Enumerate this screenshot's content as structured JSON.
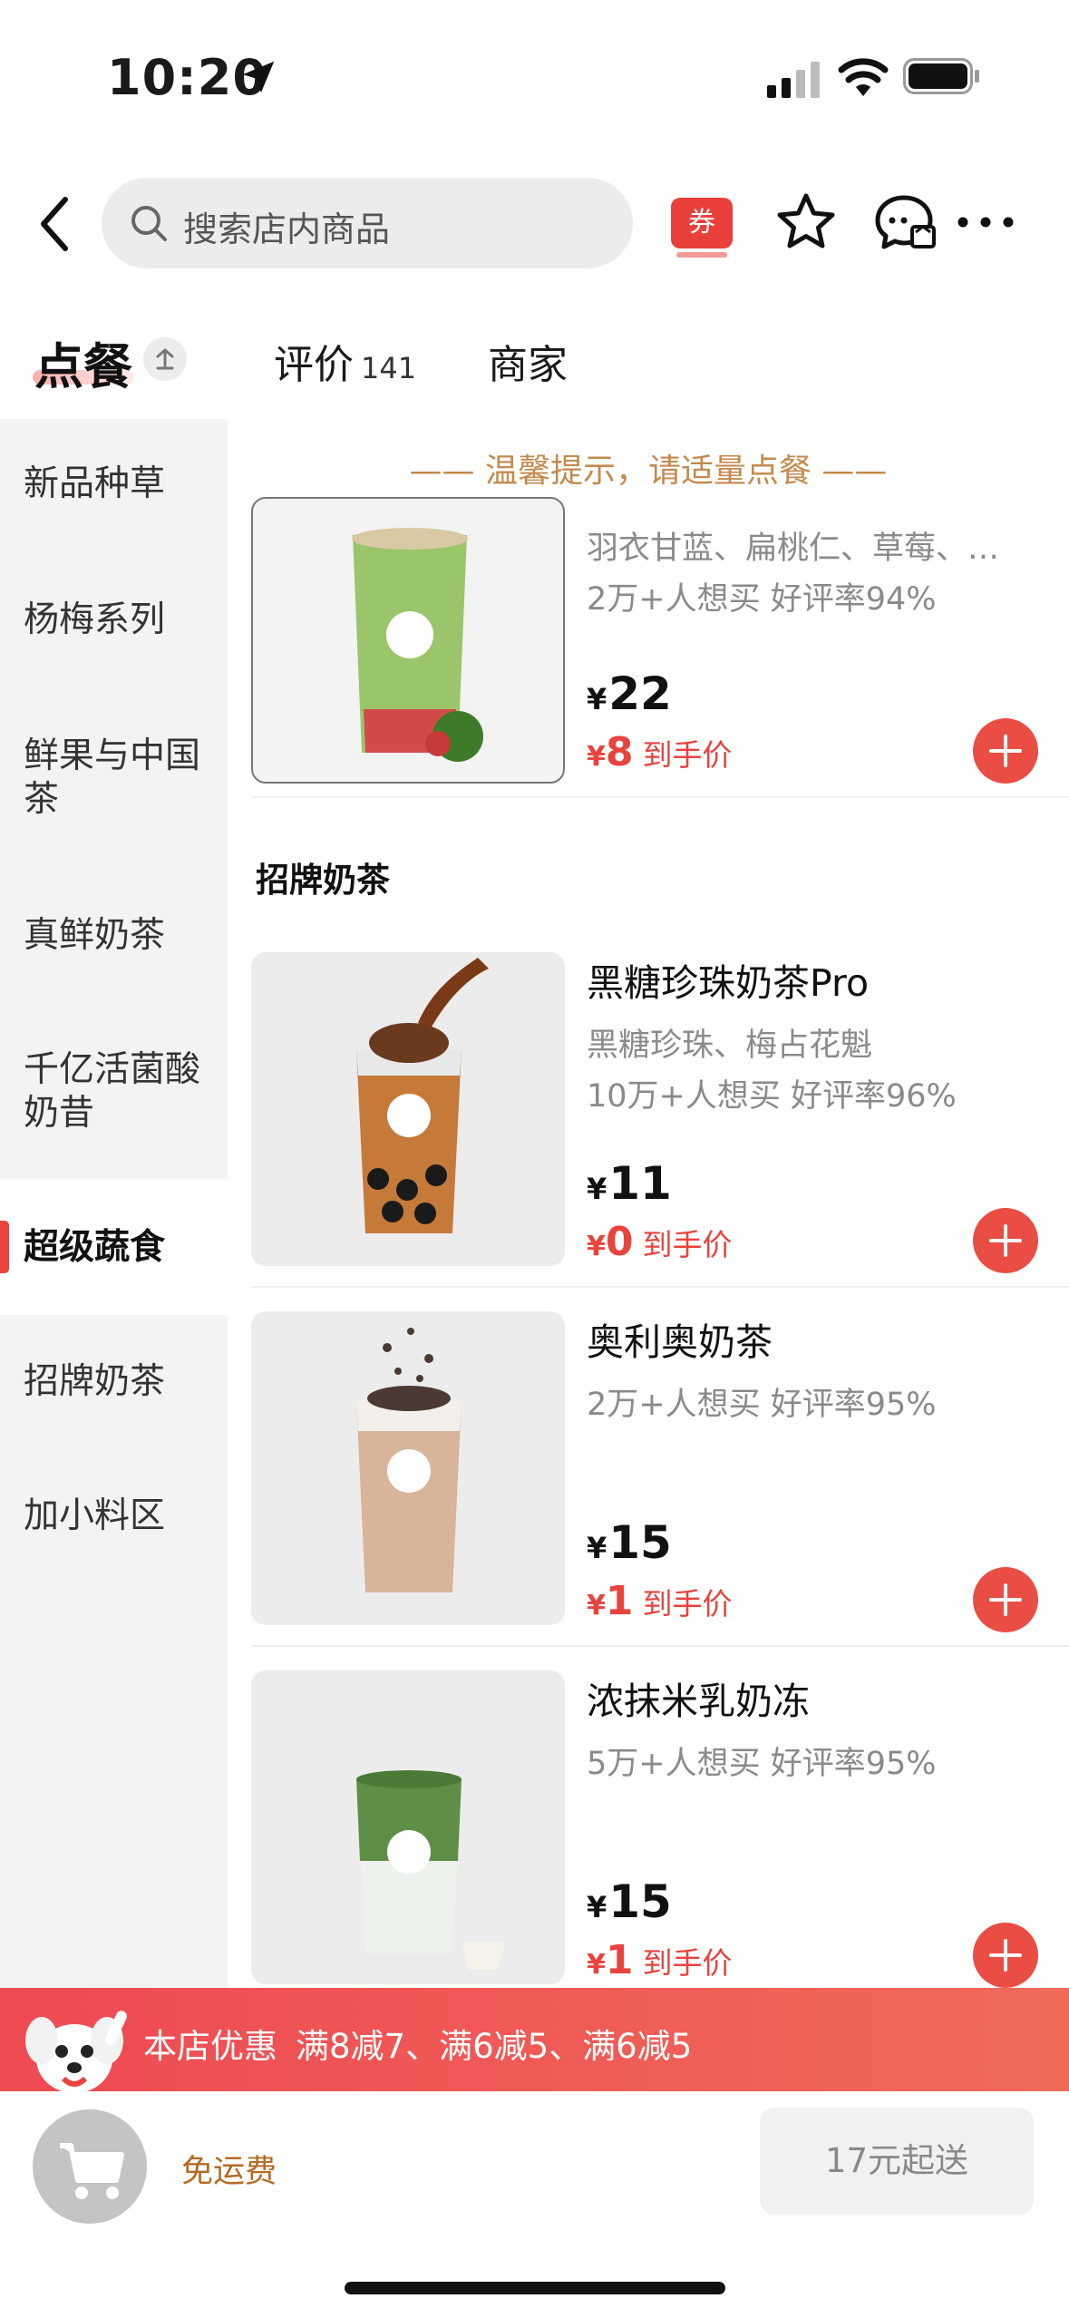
{
  "status_bar": {
    "time": "10:20"
  },
  "nav": {
    "search_placeholder": "搜索店内商品",
    "coupon_label": "券"
  },
  "tabs": {
    "order": "点餐",
    "review": "评价",
    "review_count": "141",
    "merchant": "商家"
  },
  "sidebar": {
    "items": [
      {
        "label": "新品种草"
      },
      {
        "label": "杨梅系列"
      },
      {
        "label": "鲜果与中国茶"
      },
      {
        "label": "真鲜奶茶"
      },
      {
        "label": "千亿活菌酸奶昔"
      },
      {
        "label": "超级蔬食"
      },
      {
        "label": "招牌奶茶"
      },
      {
        "label": "加小料区"
      }
    ],
    "active_index": 5
  },
  "tip": "—— 温馨提示，请适量点餐 ——",
  "products": [
    {
      "name": "",
      "desc": "羽衣甘蓝、扁桃仁、草莓、…",
      "stats": "2万+人想买 好评率94%",
      "currency": "¥",
      "price": "22",
      "deal_price": "8",
      "deal_label": "到手价",
      "image_color": "#9bc56a"
    },
    {
      "name": "黑糖珍珠奶茶Pro",
      "desc": "黑糖珍珠、梅占花魁",
      "stats": "10万+人想买 好评率96%",
      "currency": "¥",
      "price": "11",
      "deal_price": "0",
      "deal_label": "到手价",
      "image_color": "#c57a3a"
    },
    {
      "name": "奥利奥奶茶",
      "desc": "",
      "stats": "2万+人想买 好评率95%",
      "currency": "¥",
      "price": "15",
      "deal_price": "1",
      "deal_label": "到手价",
      "image_color": "#d8b49a"
    },
    {
      "name": "浓抹米乳奶冻",
      "desc": "",
      "stats": "5万+人想买 好评率95%",
      "currency": "¥",
      "price": "15",
      "deal_price": "1",
      "deal_label": "到手价",
      "image_color": "#5f8f46"
    }
  ],
  "section_title": "招牌奶茶",
  "promo": {
    "label": "本店优惠",
    "text": "满8减7、满6减5、满6减5"
  },
  "bottom": {
    "shipping": "免运费",
    "min_order": "17元起送"
  },
  "colors": {
    "accent": "#e8433d",
    "tip": "#c48a4d",
    "shipping": "#b36b23"
  }
}
